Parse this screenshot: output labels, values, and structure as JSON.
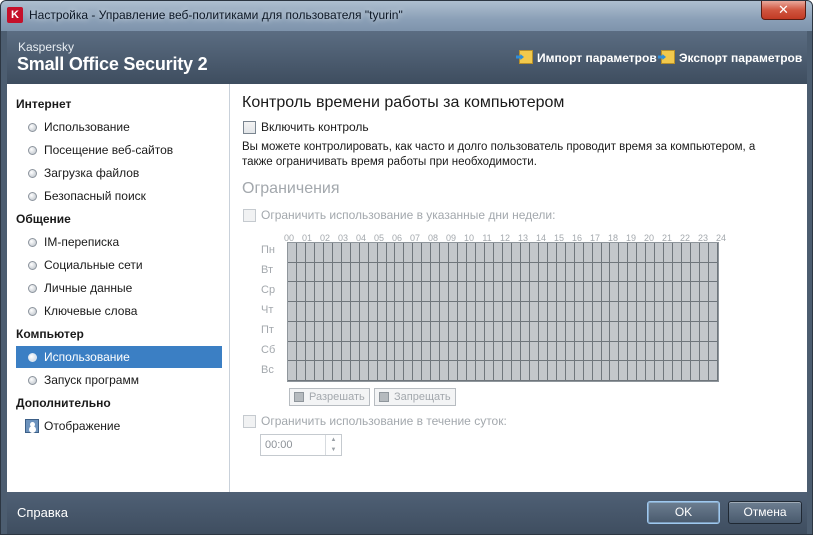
{
  "window": {
    "title": "Настройка - Управление веб-политиками для пользователя \"tyurin\"",
    "close_glyph": "✕"
  },
  "header": {
    "brand_small": "Kaspersky",
    "brand_large": "Small Office Security 2",
    "import_label": "Импорт параметров",
    "export_label": "Экспорт параметров"
  },
  "sidebar": {
    "groups": [
      {
        "label": "Интернет",
        "items": [
          "Использование",
          "Посещение веб-сайтов",
          "Загрузка файлов",
          "Безопасный поиск"
        ]
      },
      {
        "label": "Общение",
        "items": [
          "IM-переписка",
          "Социальные сети",
          "Личные данные",
          "Ключевые слова"
        ]
      },
      {
        "label": "Компьютер",
        "items": [
          "Использование",
          "Запуск программ"
        ]
      },
      {
        "label": "Дополнительно",
        "items": [
          "Отображение"
        ]
      }
    ],
    "selected": "Компьютер / Использование"
  },
  "main": {
    "title": "Контроль времени работы за компьютером",
    "enable_label": "Включить контроль",
    "description": "Вы можете контролировать, как часто и долго пользователь проводит время за компьютером, а также ограничивать время работы при необходимости.",
    "restrictions_title": "Ограничения",
    "limit_days_label": "Ограничить использование в указанные дни недели:",
    "hours": [
      "00",
      "01",
      "02",
      "03",
      "04",
      "05",
      "06",
      "07",
      "08",
      "09",
      "10",
      "11",
      "12",
      "13",
      "14",
      "15",
      "16",
      "17",
      "18",
      "19",
      "20",
      "21",
      "22",
      "23",
      "24"
    ],
    "days": [
      "Пн",
      "Вт",
      "Ср",
      "Чт",
      "Пт",
      "Сб",
      "Вс"
    ],
    "legend_allow": "Разрешать",
    "legend_deny": "Запрещать",
    "limit_daily_label": "Ограничить использование в течение суток:",
    "daily_value": "00:00"
  },
  "footer": {
    "help_label": "Справка",
    "ok_label": "OK",
    "cancel_label": "Отмена"
  },
  "colors": {
    "selected_bg": "#3b7fc4",
    "header_bg": "#3e4d5f",
    "disabled_text": "#a3a8ad"
  }
}
